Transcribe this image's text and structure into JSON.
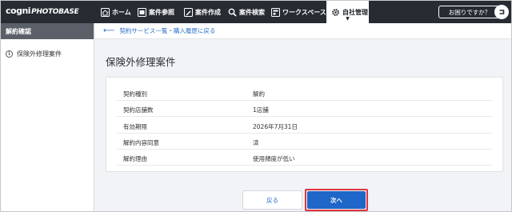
{
  "brand": {
    "part1": "cogni",
    "part2": "PHOTOBASE"
  },
  "nav": {
    "items": [
      {
        "label": "ホーム",
        "icon": "home-icon"
      },
      {
        "label": "案件参照",
        "icon": "folder-icon"
      },
      {
        "label": "案件作成",
        "icon": "create-icon"
      },
      {
        "label": "案件検索",
        "icon": "search-icon"
      },
      {
        "label": "ワークスペース",
        "icon": "workspace-icon"
      },
      {
        "label": "自社管理",
        "icon": "gear-icon",
        "active": true
      }
    ],
    "help_label": "お困りですか？",
    "user_icon": "user-icon"
  },
  "sidebar": {
    "title": "解約確認",
    "item_label": "保険外修理案件"
  },
  "breadcrumb": {
    "back_link": "契約サービス一覧・購入履歴に戻る"
  },
  "page": {
    "title": "保険外修理案件"
  },
  "details": {
    "rows": [
      {
        "key": "契約種別",
        "value": "解約"
      },
      {
        "key": "契約店舗数",
        "value": "1店舗"
      },
      {
        "key": "有効期限",
        "value": "2026年7月31日"
      },
      {
        "key": "解約内容同意",
        "value": "済"
      },
      {
        "key": "解約理由",
        "value": "使用頻度が低い"
      }
    ]
  },
  "actions": {
    "back_label": "戻る",
    "next_label": "次へ"
  },
  "colors": {
    "nav_bg": "#272c33",
    "accent_blue": "#1e66c7",
    "link_blue": "#2a6fc9",
    "highlight_red": "#e0343c"
  }
}
